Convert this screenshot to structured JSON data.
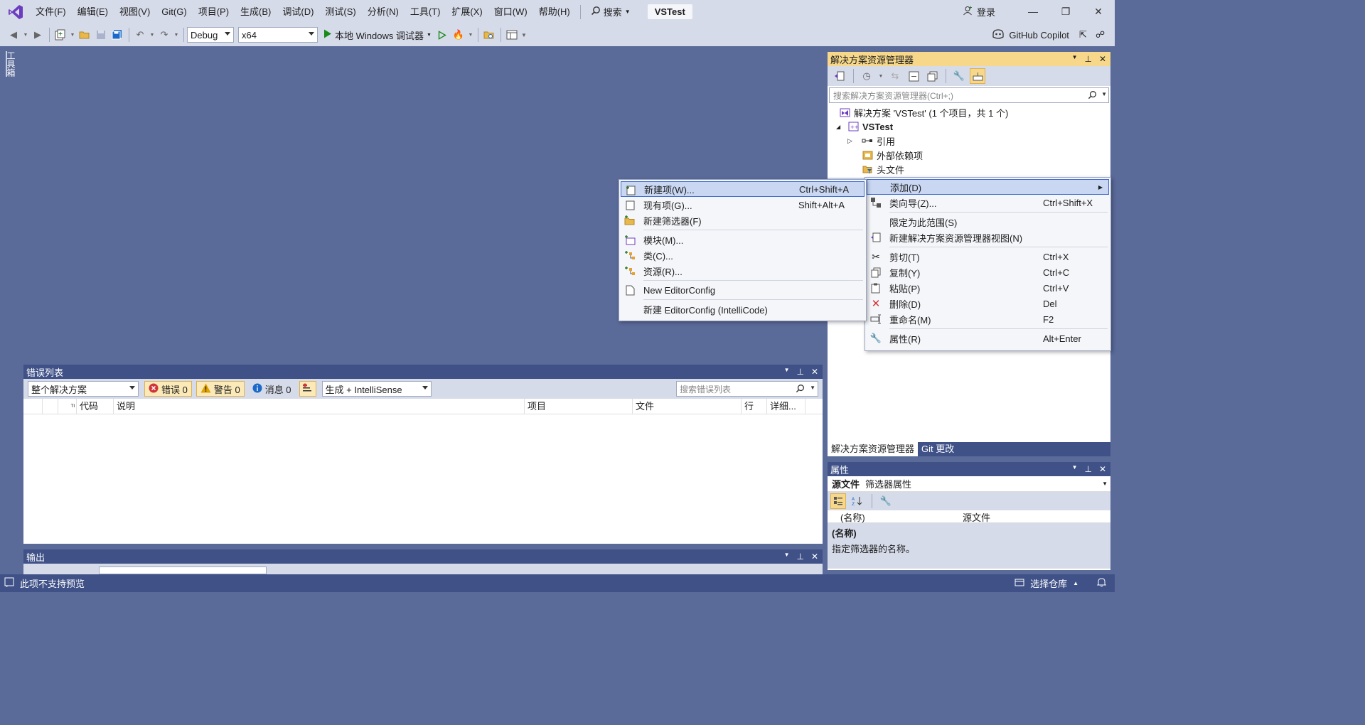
{
  "menubar": {
    "items": [
      "文件(F)",
      "编辑(E)",
      "视图(V)",
      "Git(G)",
      "项目(P)",
      "生成(B)",
      "调试(D)",
      "测试(S)",
      "分析(N)",
      "工具(T)",
      "扩展(X)",
      "窗口(W)",
      "帮助(H)"
    ],
    "search_label": "搜索",
    "solution_name": "VSTest",
    "signin_label": "登录"
  },
  "toolbar": {
    "config": "Debug",
    "platform": "x64",
    "run_label": "本地 Windows 调试器",
    "copilot_label": "GitHub Copilot"
  },
  "toolbox": {
    "label": "工具箱"
  },
  "error_list": {
    "title": "错误列表",
    "scope": "整个解决方案",
    "errors_label": "错误 0",
    "warnings_label": "警告 0",
    "messages_label": "消息 0",
    "build_filter": "生成 + IntelliSense",
    "search_placeholder": "搜索错误列表",
    "columns": [
      "代码",
      "说明",
      "项目",
      "文件",
      "行",
      "详细..."
    ]
  },
  "output": {
    "title": "输出"
  },
  "solution_explorer": {
    "title": "解决方案资源管理器",
    "search_placeholder": "搜索解决方案资源管理器(Ctrl+;)",
    "tree": {
      "solution": "解决方案 'VSTest' (1 个项目，共 1 个)",
      "project": "VSTest",
      "references": "引用",
      "external_deps": "外部依赖项",
      "header_files": "头文件"
    },
    "tabs": [
      "解决方案资源管理器",
      "Git 更改"
    ]
  },
  "properties": {
    "title": "属性",
    "object_name": "源文件",
    "object_type": "筛选器属性",
    "row_name": "(名称)",
    "row_value": "源文件",
    "desc_title": "(名称)",
    "desc_text": "指定筛选器的名称。"
  },
  "context_menu_main": [
    {
      "label": "添加(D)",
      "shortcut": ""
    },
    {
      "label": "类向导(Z)...",
      "shortcut": "Ctrl+Shift+X"
    },
    {
      "label": "限定为此范围(S)",
      "shortcut": ""
    },
    {
      "label": "新建解决方案资源管理器视图(N)",
      "shortcut": ""
    },
    {
      "label": "剪切(T)",
      "shortcut": "Ctrl+X"
    },
    {
      "label": "复制(Y)",
      "shortcut": "Ctrl+C"
    },
    {
      "label": "粘贴(P)",
      "shortcut": "Ctrl+V"
    },
    {
      "label": "删除(D)",
      "shortcut": "Del"
    },
    {
      "label": "重命名(M)",
      "shortcut": "F2"
    },
    {
      "label": "属性(R)",
      "shortcut": "Alt+Enter"
    }
  ],
  "context_menu_add": [
    {
      "label": "新建项(W)...",
      "shortcut": "Ctrl+Shift+A"
    },
    {
      "label": "现有项(G)...",
      "shortcut": "Shift+Alt+A"
    },
    {
      "label": "新建筛选器(F)",
      "shortcut": ""
    },
    {
      "label": "模块(M)...",
      "shortcut": ""
    },
    {
      "label": "类(C)...",
      "shortcut": ""
    },
    {
      "label": "资源(R)...",
      "shortcut": ""
    },
    {
      "label": "New EditorConfig",
      "shortcut": ""
    },
    {
      "label": "新建 EditorConfig (IntelliCode)",
      "shortcut": ""
    }
  ],
  "statusbar": {
    "left": "此项不支持预览",
    "repo": "选择仓库"
  }
}
